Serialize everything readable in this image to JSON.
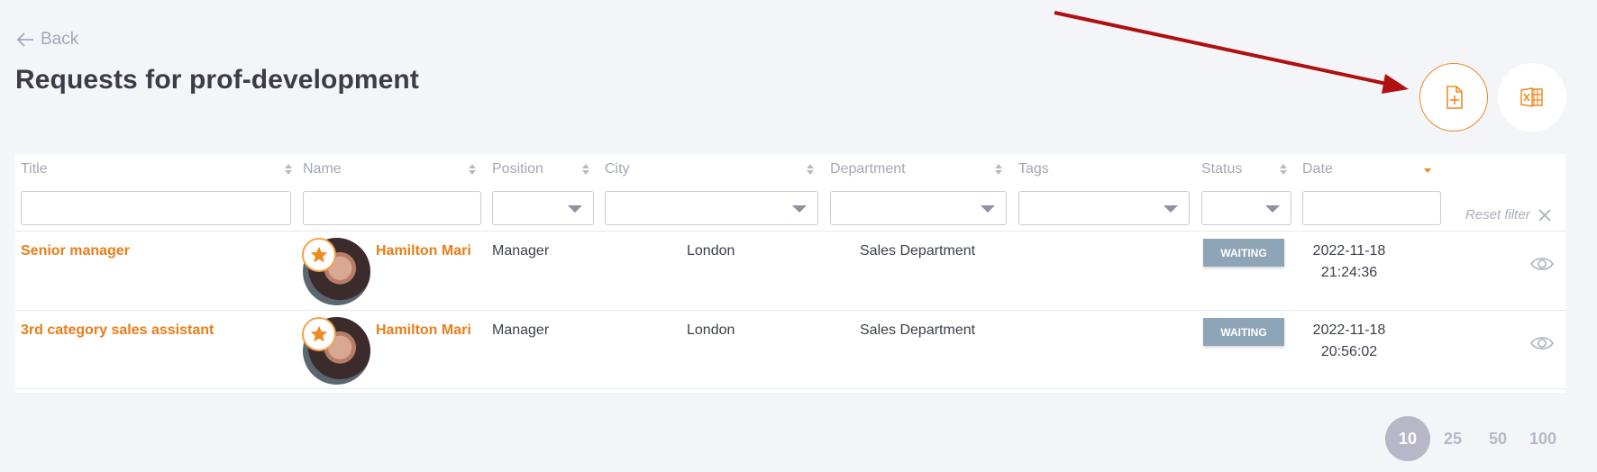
{
  "nav": {
    "back_label": "Back"
  },
  "page": {
    "title": "Requests for prof-development"
  },
  "actions": {
    "add_icon": "file-plus-icon",
    "export_icon": "excel-icon"
  },
  "table": {
    "columns": [
      {
        "label": "Title"
      },
      {
        "label": "Name"
      },
      {
        "label": "Position"
      },
      {
        "label": "City"
      },
      {
        "label": "Department"
      },
      {
        "label": "Tags"
      },
      {
        "label": "Status"
      },
      {
        "label": "Date"
      }
    ],
    "reset_filter_label": "Reset filter",
    "rows": [
      {
        "title": "Senior manager",
        "name": "Hamilton Mari",
        "position": "Manager",
        "city": "London",
        "department": "Sales Department",
        "status": "WAITING",
        "date": "2022-11-18",
        "time": "21:24:36"
      },
      {
        "title": "3rd category sales assistant",
        "name": "Hamilton Mari",
        "position": "Manager",
        "city": "London",
        "department": "Sales Department",
        "status": "WAITING",
        "date": "2022-11-18",
        "time": "20:56:02"
      }
    ]
  },
  "pagination": {
    "sizes": [
      "10",
      "25",
      "50",
      "100"
    ],
    "active": "10"
  },
  "colors": {
    "accent": "#ea7d18",
    "status_waiting": "#8ea5b8",
    "annotation_arrow": "#b01010"
  }
}
